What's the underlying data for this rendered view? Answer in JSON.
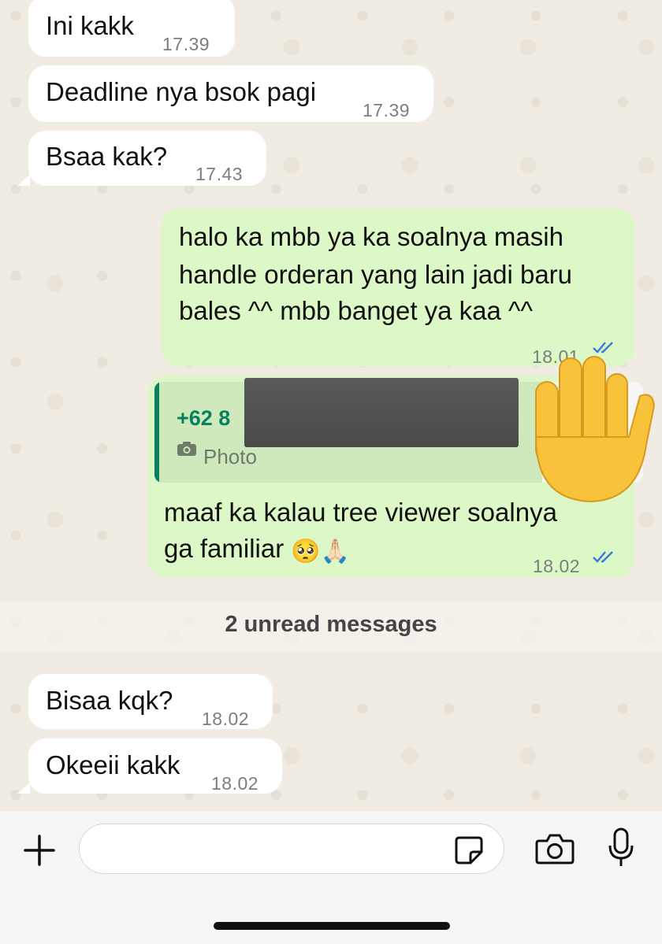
{
  "messages": [
    {
      "direction": "in",
      "text": "Ini kakk",
      "time": "17.39"
    },
    {
      "direction": "in",
      "text": "Deadline nya bsok pagi",
      "time": "17.39"
    },
    {
      "direction": "in",
      "text": "Bsaa kak?",
      "time": "17.43"
    },
    {
      "direction": "out",
      "lines": [
        "halo ka mbb ya ka soalnya masih",
        "handle orderan yang lain jadi baru",
        "bales ^^ mbb banget ya kaa ^^"
      ],
      "time": "18.01",
      "status": "read"
    },
    {
      "direction": "out",
      "quote": {
        "sender": "+62 8",
        "type_label": "Photo"
      },
      "lines": [
        "maaf ka kalau tree viewer soalnya",
        "ga familiar"
      ],
      "emoji": "🥺🙏🏻",
      "time": "18.02",
      "status": "read"
    },
    {
      "direction": "in",
      "text": "Bisaa kqk?",
      "time": "18.02"
    },
    {
      "direction": "in",
      "text": "Okeeii kakk",
      "time": "18.02"
    }
  ],
  "unread_divider": "2 unread messages",
  "colors": {
    "incoming": "#ffffff",
    "outgoing": "#dcf8c6",
    "read_ticks": "#3a7bd5",
    "quote_accent": "#07825e"
  },
  "icons": [
    "plus-icon",
    "sticker-icon",
    "camera-icon",
    "mic-icon",
    "camera-small-icon",
    "read-ticks-icon",
    "raised-hand-icon"
  ]
}
